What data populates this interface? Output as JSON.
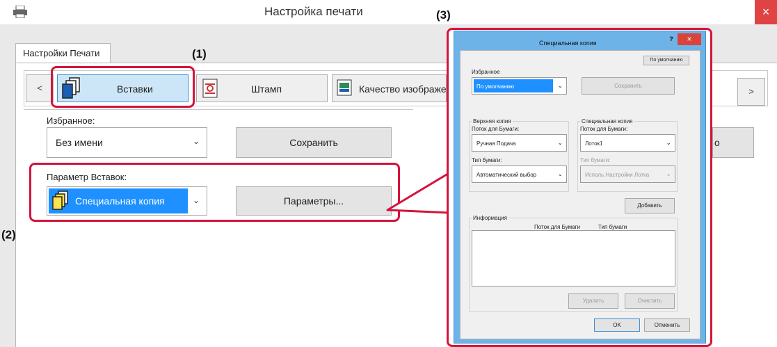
{
  "window": {
    "title": "Настройка печати",
    "close": "×"
  },
  "tabs": [
    {
      "label": "Настройки Печати"
    }
  ],
  "toolbar": {
    "prev": "<",
    "next": ">",
    "items": [
      {
        "label": "Вставки",
        "icon": "pages-icon",
        "selected": true
      },
      {
        "label": "Штамп",
        "icon": "stamp-icon"
      },
      {
        "label": "Качество изображения",
        "icon": "image-quality-icon"
      }
    ]
  },
  "favorites": {
    "label": "Избранное:",
    "value": "Без имени",
    "save": "Сохранить"
  },
  "inserts": {
    "label": "Параметр Вставок:",
    "value": "Специальная копия",
    "params": "Параметры...",
    "behind_fragment": "o"
  },
  "callouts": {
    "one": "(1)",
    "two": "(2)",
    "three": "(3)"
  },
  "dialog": {
    "title": "Специальная копия",
    "help": "?",
    "close": "×",
    "default_btn": "По умолчанию",
    "favorites": {
      "label": "Избранное",
      "value": "По умолчанию",
      "save": "Сохранить"
    },
    "top_copy": {
      "group": "Верхняя копия",
      "feed_label": "Поток для Бумаги:",
      "feed": "Ручная Подача",
      "type_label": "Тип бумаги:",
      "type": "Автоматический выбор"
    },
    "special_copy": {
      "group": "Специальная копия",
      "feed_label": "Поток для Бумаги:",
      "feed": "Лоток1",
      "type_label": "Тип бумаги:",
      "type": "Исполь.Настройки Лотка"
    },
    "add": "Добавить",
    "info": {
      "group": "Информация",
      "col1": "Поток для Бумаги",
      "col2": "Тип бумаги"
    },
    "delete": "Удалить",
    "clear": "Очистить",
    "ok": "OK",
    "cancel": "Отменить"
  },
  "colors": {
    "accent": "#d4143c",
    "selection": "#1e90ff",
    "dialog_frame": "#6eb3e8"
  }
}
